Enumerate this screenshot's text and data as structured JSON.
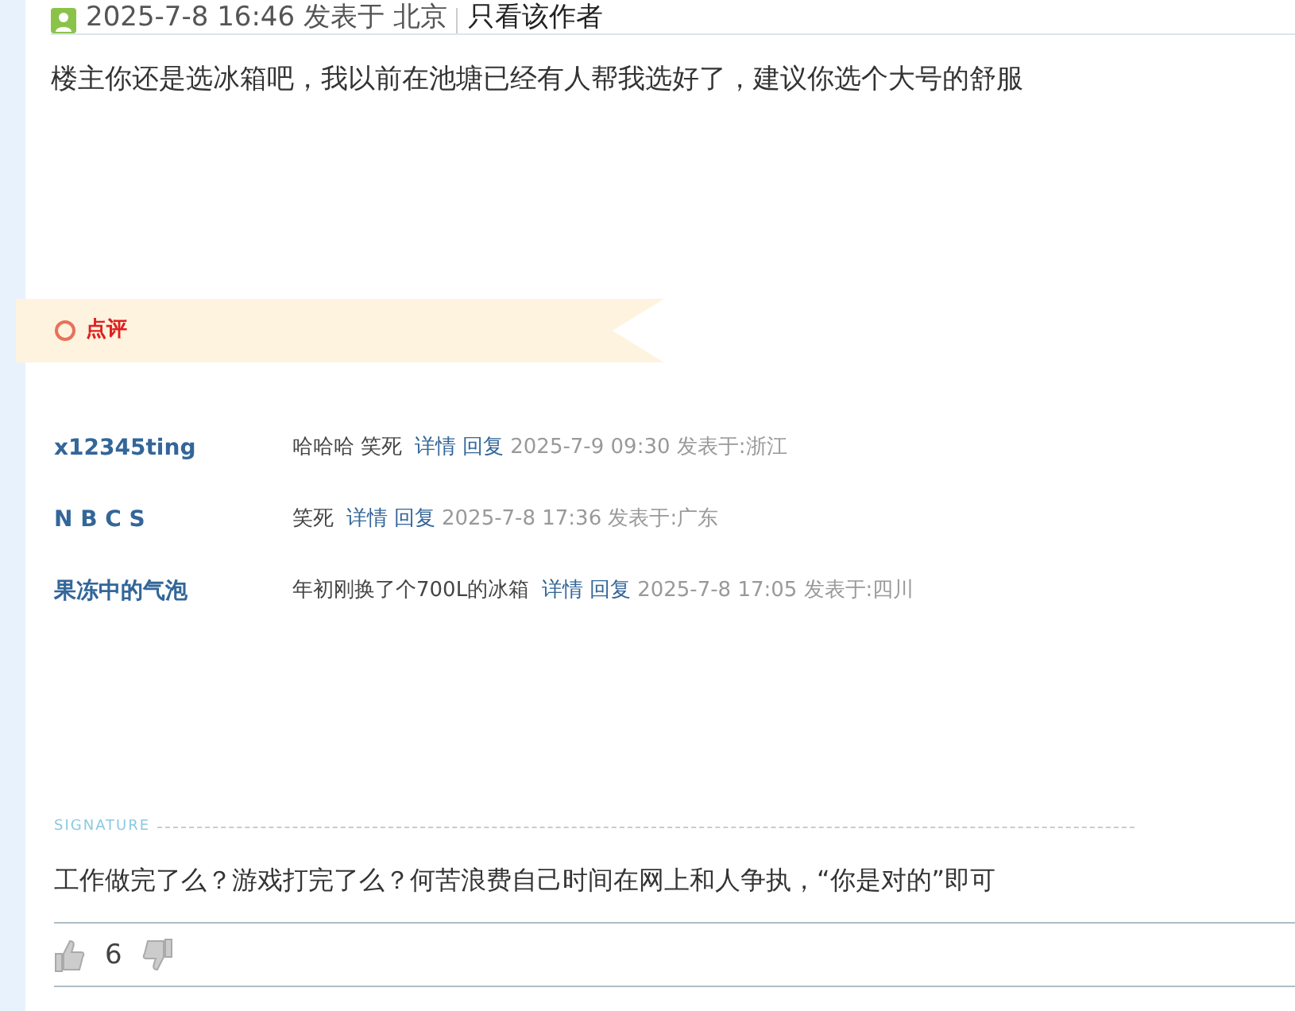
{
  "post_meta": {
    "time": "2025-7-8 16:46 发表于 北京",
    "author_only": "只看该作者"
  },
  "post_text": "楼主你还是选冰箱吧，我以前在池塘已经有人帮我选好了，建议你选个大号的舒服",
  "review_banner": {
    "title": "点评"
  },
  "comments": [
    {
      "user": "x12345ting",
      "text": "哈哈哈 笑死",
      "detail": "详情",
      "reply": "回复",
      "time": "2025-7-9 09:30 发表于:浙江"
    },
    {
      "user": "N B C S",
      "text": "笑死",
      "detail": "详情",
      "reply": "回复",
      "time": "2025-7-8 17:36 发表于:广东"
    },
    {
      "user": "果冻中的气泡",
      "text": "年初刚换了个700L的冰箱",
      "detail": "详情",
      "reply": "回复",
      "time": "2025-7-8 17:05 发表于:四川"
    }
  ],
  "signature": {
    "label": "SIGNATURE",
    "text": "工作做完了么？游戏打完了么？何苦浪费自己时间在网上和人争执，“你是对的”即可"
  },
  "votes": {
    "likes": "6"
  }
}
